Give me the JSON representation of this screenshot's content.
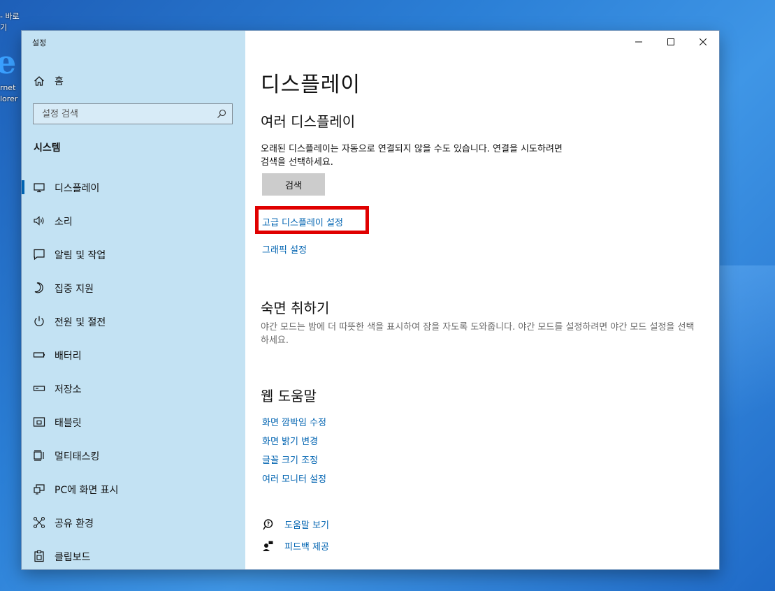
{
  "desktop": {
    "shortcut_caption_1": "- 바로",
    "shortcut_caption_2": "기",
    "ie_caption_1": "rnet",
    "ie_caption_2": "lorer"
  },
  "window": {
    "app_title": "설정"
  },
  "sidebar": {
    "home_label": "홈",
    "search_placeholder": "설정 검색",
    "section_title": "시스템",
    "items": [
      {
        "label": "디스플레이",
        "icon": "monitor-icon"
      },
      {
        "label": "소리",
        "icon": "speaker-icon"
      },
      {
        "label": "알림 및 작업",
        "icon": "notification-icon"
      },
      {
        "label": "집중 지원",
        "icon": "moon-icon"
      },
      {
        "label": "전원 및 절전",
        "icon": "power-icon"
      },
      {
        "label": "배터리",
        "icon": "battery-icon"
      },
      {
        "label": "저장소",
        "icon": "storage-icon"
      },
      {
        "label": "태블릿",
        "icon": "tablet-icon"
      },
      {
        "label": "멀티태스킹",
        "icon": "multitasking-icon"
      },
      {
        "label": "PC에 화면 표시",
        "icon": "project-icon"
      },
      {
        "label": "공유 환경",
        "icon": "shared-experiences-icon"
      },
      {
        "label": "클립보드",
        "icon": "clipboard-icon"
      }
    ]
  },
  "content": {
    "page_title": "디스플레이",
    "multi_display": {
      "heading": "여러 디스플레이",
      "description": "오래된 디스플레이는 자동으로 연결되지 않을 수도 있습니다. 연결을 시도하려면 검색을 선택하세요.",
      "detect_button": "검색",
      "advanced_link": "고급 디스플레이 설정",
      "graphics_link": "그래픽 설정"
    },
    "sleep_better": {
      "heading": "숙면 취하기",
      "description": "야간 모드는 밤에 더 따뜻한 색을 표시하여 잠을 자도록 도와줍니다. 야간 모드를 설정하려면 야간 모드 설정을 선택하세요."
    },
    "web_help": {
      "heading": "웹 도움말",
      "links": [
        "화면 깜박임 수정",
        "화면 밝기 변경",
        "글꼴 크기 조정",
        "여러 모니터 설정"
      ]
    },
    "help": {
      "get_help": "도움말 보기",
      "feedback": "피드백 제공"
    }
  },
  "colors": {
    "accent": "#0063b1",
    "sidebar_bg": "#c3e2f3",
    "highlight": "#e00000"
  }
}
